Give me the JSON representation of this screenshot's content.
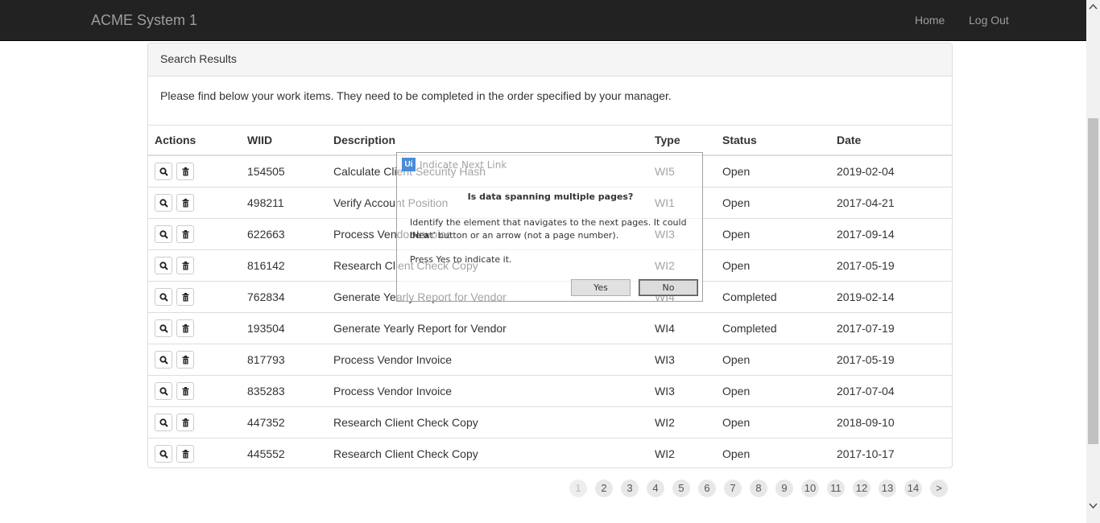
{
  "navbar": {
    "brand": "ACME System 1",
    "links": [
      "Home",
      "Log Out"
    ]
  },
  "panel": {
    "heading": "Search Results",
    "intro": "Please find below your work items. They need to be completed in the order specified by your manager."
  },
  "table": {
    "headers": [
      "Actions",
      "WIID",
      "Description",
      "Type",
      "Status",
      "Date"
    ],
    "rows": [
      {
        "wiid": "154505",
        "description": "Calculate Client Security Hash",
        "type": "WI5",
        "status": "Open",
        "date": "2019-02-04"
      },
      {
        "wiid": "498211",
        "description": "Verify Account Position",
        "type": "WI1",
        "status": "Open",
        "date": "2017-04-21"
      },
      {
        "wiid": "622663",
        "description": "Process Vendor Invoice",
        "type": "WI3",
        "status": "Open",
        "date": "2017-09-14"
      },
      {
        "wiid": "816142",
        "description": "Research Client Check Copy",
        "type": "WI2",
        "status": "Open",
        "date": "2017-05-19"
      },
      {
        "wiid": "762834",
        "description": "Generate Yearly Report for Vendor",
        "type": "WI4",
        "status": "Completed",
        "date": "2019-02-14"
      },
      {
        "wiid": "193504",
        "description": "Generate Yearly Report for Vendor",
        "type": "WI4",
        "status": "Completed",
        "date": "2017-07-19"
      },
      {
        "wiid": "817793",
        "description": "Process Vendor Invoice",
        "type": "WI3",
        "status": "Open",
        "date": "2017-05-19"
      },
      {
        "wiid": "835283",
        "description": "Process Vendor Invoice",
        "type": "WI3",
        "status": "Open",
        "date": "2017-07-04"
      },
      {
        "wiid": "447352",
        "description": "Research Client Check Copy",
        "type": "WI2",
        "status": "Open",
        "date": "2018-09-10"
      },
      {
        "wiid": "445552",
        "description": "Research Client Check Copy",
        "type": "WI2",
        "status": "Open",
        "date": "2017-10-17"
      }
    ],
    "row_action_icons": [
      "search-icon",
      "trash-icon"
    ]
  },
  "pagination": {
    "pages": [
      "1",
      "2",
      "3",
      "4",
      "5",
      "6",
      "7",
      "8",
      "9",
      "10",
      "11",
      "12",
      "13",
      "14",
      ">"
    ],
    "active": "1"
  },
  "dialog": {
    "logo": "Ui",
    "title": "Indicate Next Link",
    "question": "Is data spanning multiple pages?",
    "line1": "Identify the element that navigates to the next pages. It could be a",
    "line2": "'Next' button or an arrow (not a page number).",
    "line3": "Press Yes to indicate it.",
    "yes_label": "Yes",
    "no_label": "No"
  }
}
